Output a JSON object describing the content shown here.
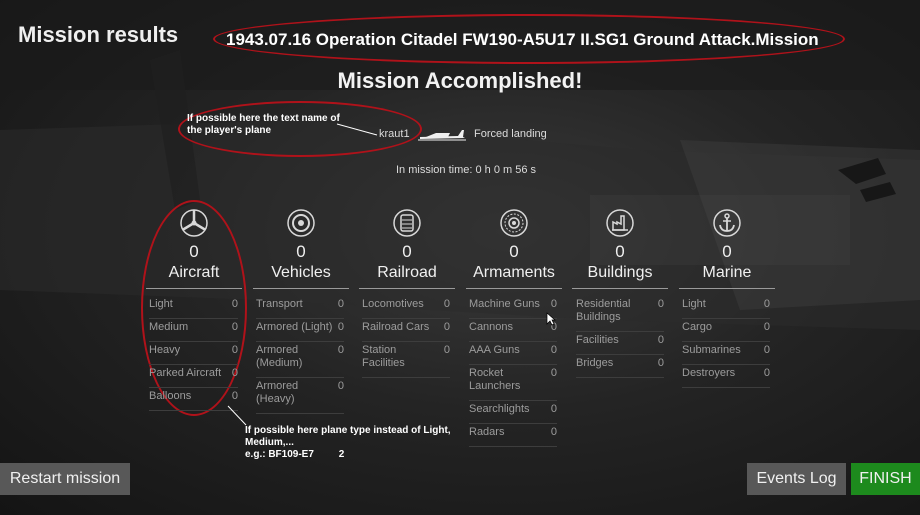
{
  "header": {
    "title": "Mission results",
    "mission_name": "1943.07.16 Operation Citadel FW190-A5U17 II.SG1 Ground Attack.Mission",
    "status": "Mission Accomplished!"
  },
  "player": {
    "name": "kraut1",
    "result": "Forced landing",
    "mission_time": "In mission time: 0 h 0 m 56 s"
  },
  "annotations": {
    "top_note": "If possible here the text name of the player's plane",
    "bottom_note_line1": "If possible here plane type instead of Light,",
    "bottom_note_line2": "Medium,...",
    "bottom_note_line3_label": "e.g.: BF109-E7",
    "bottom_note_line3_value": "2"
  },
  "categories": [
    {
      "name": "Aircraft",
      "total": "0",
      "icon": "propeller-icon",
      "rows": [
        {
          "label": "Light",
          "value": "0"
        },
        {
          "label": "Medium",
          "value": "0"
        },
        {
          "label": "Heavy",
          "value": "0"
        },
        {
          "label": "Parked Aircraft",
          "value": "0"
        },
        {
          "label": "Balloons",
          "value": "0"
        }
      ]
    },
    {
      "name": "Vehicles",
      "total": "0",
      "icon": "wheel-icon",
      "rows": [
        {
          "label": "Transport",
          "value": "0"
        },
        {
          "label": "Armored (Light)",
          "value": "0"
        },
        {
          "label": "Armored\n(Medium)",
          "value": "0"
        },
        {
          "label": "Armored\n(Heavy)",
          "value": "0"
        }
      ]
    },
    {
      "name": "Railroad",
      "total": "0",
      "icon": "locomotive-icon",
      "rows": [
        {
          "label": "Locomotives",
          "value": "0"
        },
        {
          "label": "Railroad Cars",
          "value": "0"
        },
        {
          "label": "Station\nFacilities",
          "value": "0"
        }
      ]
    },
    {
      "name": "Armaments",
      "total": "0",
      "icon": "gun-muzzle-icon",
      "rows": [
        {
          "label": "Machine Guns",
          "value": "0"
        },
        {
          "label": "Cannons",
          "value": "0"
        },
        {
          "label": "AAA Guns",
          "value": "0"
        },
        {
          "label": "Rocket\nLaunchers",
          "value": "0"
        },
        {
          "label": "Searchlights",
          "value": "0"
        },
        {
          "label": "Radars",
          "value": "0"
        }
      ]
    },
    {
      "name": "Buildings",
      "total": "0",
      "icon": "factory-icon",
      "rows": [
        {
          "label": "Residential\nBuildings",
          "value": "0"
        },
        {
          "label": "Facilities",
          "value": "0"
        },
        {
          "label": "Bridges",
          "value": "0"
        }
      ]
    },
    {
      "name": "Marine",
      "total": "0",
      "icon": "anchor-icon",
      "rows": [
        {
          "label": "Light",
          "value": "0"
        },
        {
          "label": "Cargo",
          "value": "0"
        },
        {
          "label": "Submarines",
          "value": "0"
        },
        {
          "label": "Destroyers",
          "value": "0"
        }
      ]
    }
  ],
  "buttons": {
    "restart": "Restart mission",
    "events_log": "Events Log",
    "finish": "FINISH"
  },
  "colors": {
    "finish_green": "#1d8a1d",
    "button_gray": "#585858",
    "annotation_red": "#b0121a"
  }
}
